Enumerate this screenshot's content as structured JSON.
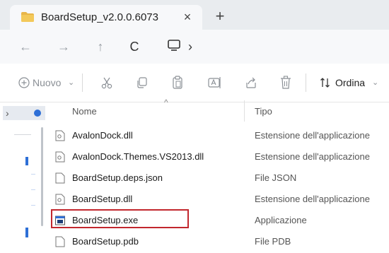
{
  "tab": {
    "title": "BoardSetup_v2.0.0.6073",
    "close_glyph": "×",
    "new_glyph": "+"
  },
  "nav": {
    "back": "←",
    "forward": "→",
    "up": "↑",
    "refresh": "C",
    "crumb_arrow": "›"
  },
  "toolbar": {
    "new_label": "Nuovo",
    "new_chevron": "⌄",
    "sort_label": "Ordina",
    "sort_chevron": "⌄",
    "icons": [
      "cut-icon",
      "copy-icon",
      "paste-icon",
      "rename-icon",
      "share-icon",
      "delete-icon"
    ]
  },
  "columns": {
    "name": "Nome",
    "type": "Tipo"
  },
  "files": [
    {
      "name": "AvalonDock.dll",
      "type": "Estensione dell'applicazione",
      "icon": "dll-icon"
    },
    {
      "name": "AvalonDock.Themes.VS2013.dll",
      "type": "Estensione dell'applicazione",
      "icon": "dll-icon"
    },
    {
      "name": "BoardSetup.deps.json",
      "type": "File JSON",
      "icon": "file-icon"
    },
    {
      "name": "BoardSetup.dll",
      "type": "Estensione dell'applicazione",
      "icon": "dll-icon"
    },
    {
      "name": "BoardSetup.exe",
      "type": "Applicazione",
      "icon": "exe-icon",
      "highlighted": true
    },
    {
      "name": "BoardSetup.pdb",
      "type": "File PDB",
      "icon": "file-icon"
    }
  ],
  "colors": {
    "highlight_border": "#c2272d",
    "accent": "#2e6fd6",
    "folder": "#e8b64a"
  }
}
